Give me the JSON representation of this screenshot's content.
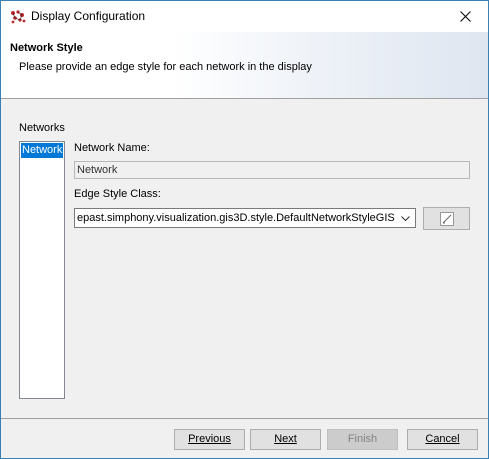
{
  "window": {
    "title": "Display Configuration",
    "icon": "repast-app-icon",
    "close_icon": "close-icon"
  },
  "header": {
    "title": "Network Style",
    "subtitle": "Please provide an edge style for each network in the display"
  },
  "networks": {
    "label": "Networks",
    "items": [
      "Network"
    ],
    "selected": "Network"
  },
  "form": {
    "name_label": "Network Name:",
    "name_value": "Network",
    "class_label": "Edge Style Class:",
    "class_value": "epast.simphony.visualization.gis3D.style.DefaultNetworkStyleGIS",
    "edit_icon": "edit-icon"
  },
  "footer": {
    "previous_label": "Previous",
    "next_label": "Next",
    "finish_label": "Finish",
    "cancel_label": "Cancel",
    "finish_enabled": false
  },
  "colors": {
    "selection": "#0078d7",
    "window_border": "#3c7fb1"
  }
}
